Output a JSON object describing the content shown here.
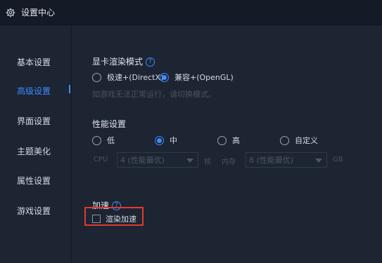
{
  "window": {
    "title": "设置中心",
    "icon": "gear-icon"
  },
  "sidebar": {
    "items": [
      {
        "label": "基本设置"
      },
      {
        "label": "高级设置"
      },
      {
        "label": "界面设置"
      },
      {
        "label": "主题美化"
      },
      {
        "label": "属性设置"
      },
      {
        "label": "游戏设置"
      }
    ],
    "active_index": 1
  },
  "render_mode": {
    "title": "显卡渲染模式",
    "help": "?",
    "options": [
      {
        "label": "极速+(DirectX)",
        "checked": false
      },
      {
        "label": "兼容+(OpenGL)",
        "checked": true
      }
    ],
    "hint": "如游戏无法正常运行，请切换模式。"
  },
  "performance": {
    "title": "性能设置",
    "options": [
      {
        "label": "低",
        "checked": false
      },
      {
        "label": "中",
        "checked": true
      },
      {
        "label": "高",
        "checked": false
      },
      {
        "label": "自定义",
        "checked": false
      }
    ],
    "cpu_label": "CPU",
    "cpu_value": "4 (性能最优)",
    "cpu_unit": "核",
    "mem_label": "内存",
    "mem_value": "8 (性能最优)",
    "mem_unit": "GB"
  },
  "acceleration": {
    "title": "加速",
    "help": "?",
    "checkbox_label": "渲染加速",
    "checked": false
  },
  "colors": {
    "accent": "#3d8bff",
    "highlight_border": "#e23a2e",
    "background": "#1d2432",
    "titlebar": "#141a26"
  }
}
